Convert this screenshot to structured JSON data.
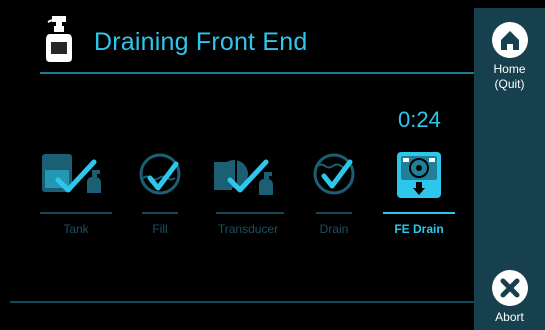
{
  "header": {
    "title": "Draining Front End"
  },
  "timer": "0:24",
  "steps": [
    {
      "label": "Tank",
      "state": "done"
    },
    {
      "label": "Fill",
      "state": "done"
    },
    {
      "label": "Transducer",
      "state": "done"
    },
    {
      "label": "Drain",
      "state": "done"
    },
    {
      "label": "FE Drain",
      "state": "active"
    }
  ],
  "sidebar": {
    "home_label": "Home (Quit)",
    "abort_label": "Abort"
  },
  "colors": {
    "accent": "#2ec7ec",
    "dim": "#15495a",
    "sidebar": "#16404d",
    "background": "#000000"
  }
}
